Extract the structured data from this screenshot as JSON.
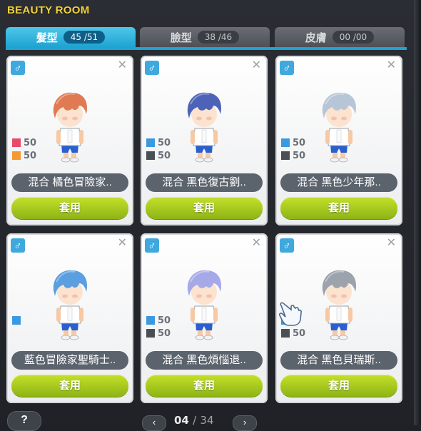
{
  "title": "BEAUTY ROOM",
  "tabs": [
    {
      "label": "髮型",
      "count": "45 /51",
      "active": true
    },
    {
      "label": "臉型",
      "count": "38 /46",
      "active": false
    },
    {
      "label": "皮膚",
      "count": "00 /00",
      "active": false
    }
  ],
  "cards": [
    {
      "gender": "♂",
      "stats": [
        {
          "value": "50",
          "color": "#e84a6a"
        },
        {
          "value": "50",
          "color": "#f59a32"
        }
      ],
      "name": "混合  橘色冒險家..",
      "apply": "套用",
      "hair_color": "#e07a52"
    },
    {
      "gender": "♂",
      "stats": [
        {
          "value": "50",
          "color": "#3b99e0"
        },
        {
          "value": "50",
          "color": "#4a4e55"
        }
      ],
      "name": "混合  黑色復古劉..",
      "apply": "套用",
      "hair_color": "#4d63b8"
    },
    {
      "gender": "♂",
      "stats": [
        {
          "value": "50",
          "color": "#3b99e0"
        },
        {
          "value": "50",
          "color": "#4a4e55"
        }
      ],
      "name": "混合  黑色少年那..",
      "apply": "套用",
      "hair_color": "#b6c6d6"
    },
    {
      "gender": "♂",
      "stats": [
        {
          "value": "",
          "color": "#3b99e0"
        }
      ],
      "name": "藍色冒險家聖騎士..",
      "apply": "套用",
      "hair_color": "#5b9fe0"
    },
    {
      "gender": "♂",
      "stats": [
        {
          "value": "50",
          "color": "#3b99e0"
        },
        {
          "value": "50",
          "color": "#4a4e55"
        }
      ],
      "name": "混合  黑色煩惱退..",
      "apply": "套用",
      "hair_color": "#a6a9e8"
    },
    {
      "gender": "♂",
      "stats": [
        {
          "value": "",
          "color": "#3b99e0"
        },
        {
          "value": "50",
          "color": "#4a4e55"
        }
      ],
      "name": "混合  黑色貝瑞斯..",
      "apply": "套用",
      "hair_color": "#9ca3ad"
    }
  ],
  "footer": {
    "help": "?",
    "prev": "‹",
    "next": "›",
    "page_current": "04",
    "page_sep": "/",
    "page_total": "34"
  },
  "colors": {
    "accent": "#1ea3d2",
    "apply": "#a6c81e",
    "title": "#f2d23b"
  }
}
